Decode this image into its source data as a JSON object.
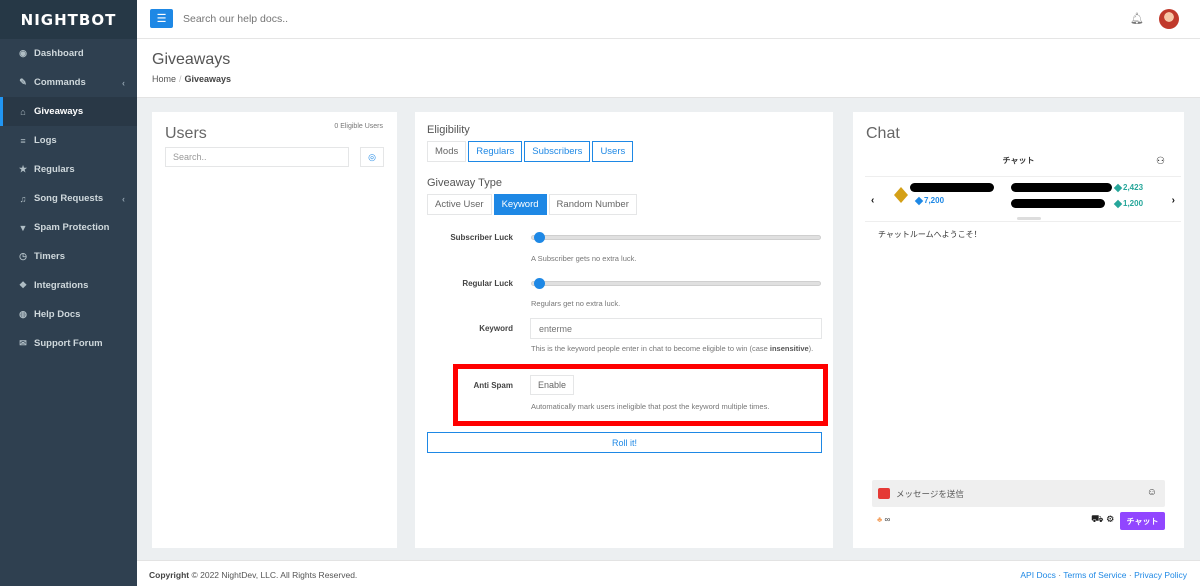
{
  "brand": {
    "logo": "NIGHTBOT"
  },
  "sidebar": {
    "items": [
      {
        "label": "Dashboard",
        "icon": "dashboard-icon",
        "glyph": "◉"
      },
      {
        "label": "Commands",
        "icon": "wand-icon",
        "glyph": "✎",
        "chevron": "‹"
      },
      {
        "label": "Giveaways",
        "icon": "gift-icon",
        "glyph": "⌂",
        "active": true
      },
      {
        "label": "Logs",
        "icon": "database-icon",
        "glyph": "≡"
      },
      {
        "label": "Regulars",
        "icon": "star-icon",
        "glyph": "★"
      },
      {
        "label": "Song Requests",
        "icon": "music-icon",
        "glyph": "♫",
        "chevron": "‹"
      },
      {
        "label": "Spam Protection",
        "icon": "filter-icon",
        "glyph": "▼"
      },
      {
        "label": "Timers",
        "icon": "clock-icon",
        "glyph": "◷"
      },
      {
        "label": "Integrations",
        "icon": "cubes-icon",
        "glyph": "❖"
      },
      {
        "label": "Help Docs",
        "icon": "globe-icon",
        "glyph": "◍"
      },
      {
        "label": "Support Forum",
        "icon": "comments-icon",
        "glyph": "✉"
      }
    ]
  },
  "topbar": {
    "search_placeholder": "Search our help docs.."
  },
  "header": {
    "title": "Giveaways",
    "breadcrumb_home": "Home",
    "breadcrumb_sep": "/",
    "breadcrumb_current": "Giveaways"
  },
  "users": {
    "title": "Users",
    "count": "0 Eligible Users",
    "search_placeholder": "Search.."
  },
  "eligibility": {
    "title": "Eligibility",
    "buttons": [
      "Mods",
      "Regulars",
      "Subscribers",
      "Users"
    ],
    "type_title": "Giveaway Type",
    "type_buttons": [
      "Active User",
      "Keyword",
      "Random Number"
    ],
    "subscriber_luck_label": "Subscriber Luck",
    "subscriber_luck_value": 0,
    "subscriber_luck_help": "A Subscriber gets no extra luck.",
    "regular_luck_label": "Regular Luck",
    "regular_luck_value": 0,
    "regular_luck_help": "Regulars get no extra luck.",
    "keyword_label": "Keyword",
    "keyword_placeholder": "enterme",
    "keyword_help_pre": "This is the keyword people enter in chat to become eligible to win (case ",
    "keyword_help_bold": "insensitive",
    "keyword_help_post": ").",
    "antispam_label": "Anti Spam",
    "antispam_button": "Enable",
    "antispam_help": "Automatically mark users ineligible that post the keyword multiple times.",
    "roll_button": "Roll it!",
    "highlight_color": "#ff0000"
  },
  "chat": {
    "title": "Chat",
    "header": "チャット",
    "points": {
      "p1": "7,200",
      "p2": "2,423",
      "p3": "1,200"
    },
    "welcome": "チャットルームへようこそ！",
    "message_placeholder": "メッセージを送信",
    "infinity": "∞",
    "send_button": "チャット"
  },
  "footer": {
    "copyright_bold": "Copyright",
    "copyright_rest": " © 2022 NightDev, LLC. All Rights Reserved.",
    "links": [
      "API Docs",
      "Terms of Service",
      "Privacy Policy"
    ],
    "link_sep": " · "
  },
  "colors": {
    "accent": "#1e88e5",
    "sidebar": "#2f4050",
    "twitch": "#9146ff"
  }
}
